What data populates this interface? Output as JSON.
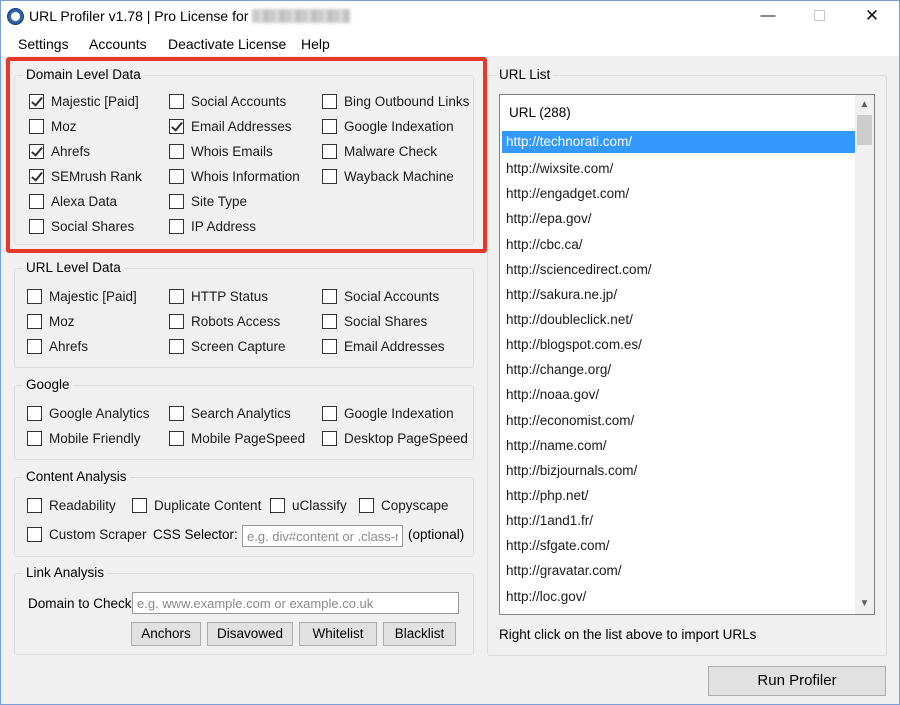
{
  "window": {
    "title_prefix": "URL Profiler v1.78 | Pro License for",
    "minimize_glyph": "—",
    "close_glyph": "✕"
  },
  "menu": [
    "Settings",
    "Accounts",
    "Deactivate License",
    "Help"
  ],
  "domain_level": {
    "label": "Domain Level Data",
    "items": [
      {
        "label": "Majestic [Paid]",
        "checked": true
      },
      {
        "label": "Moz",
        "checked": false
      },
      {
        "label": "Ahrefs",
        "checked": true
      },
      {
        "label": "SEMrush Rank",
        "checked": true
      },
      {
        "label": "Alexa Data",
        "checked": false
      },
      {
        "label": "Social Shares",
        "checked": false
      },
      {
        "label": "Social Accounts",
        "checked": false
      },
      {
        "label": "Email Addresses",
        "checked": true
      },
      {
        "label": "Whois Emails",
        "checked": false
      },
      {
        "label": "Whois Information",
        "checked": false
      },
      {
        "label": "Site Type",
        "checked": false
      },
      {
        "label": "IP Address",
        "checked": false
      },
      {
        "label": "Bing Outbound Links",
        "checked": false
      },
      {
        "label": "Google Indexation",
        "checked": false
      },
      {
        "label": "Malware Check",
        "checked": false
      },
      {
        "label": "Wayback Machine",
        "checked": false
      }
    ]
  },
  "url_level": {
    "label": "URL Level Data",
    "items": [
      {
        "label": "Majestic [Paid]",
        "checked": false
      },
      {
        "label": "Moz",
        "checked": false
      },
      {
        "label": "Ahrefs",
        "checked": false
      },
      {
        "label": "HTTP Status",
        "checked": false
      },
      {
        "label": "Robots Access",
        "checked": false
      },
      {
        "label": "Screen Capture",
        "checked": false
      },
      {
        "label": "Social Accounts",
        "checked": false
      },
      {
        "label": "Social Shares",
        "checked": false
      },
      {
        "label": "Email Addresses",
        "checked": false
      }
    ]
  },
  "google": {
    "label": "Google",
    "items": [
      {
        "label": "Google Analytics",
        "checked": false
      },
      {
        "label": "Mobile Friendly",
        "checked": false
      },
      {
        "label": "Search Analytics",
        "checked": false
      },
      {
        "label": "Mobile PageSpeed",
        "checked": false
      },
      {
        "label": "Google Indexation",
        "checked": false
      },
      {
        "label": "Desktop PageSpeed",
        "checked": false
      }
    ]
  },
  "content_analysis": {
    "label": "Content Analysis",
    "items": [
      {
        "label": "Readability",
        "checked": false
      },
      {
        "label": "Duplicate Content",
        "checked": false
      },
      {
        "label": "uClassify",
        "checked": false
      },
      {
        "label": "Copyscape",
        "checked": false
      },
      {
        "label": "Custom Scraper",
        "checked": false
      }
    ],
    "css_selector_label": "CSS Selector:",
    "css_selector_placeholder": "e.g. div#content or .class-name",
    "optional_label": "(optional)"
  },
  "link_analysis": {
    "label": "Link Analysis",
    "domain_label": "Domain to Check:",
    "domain_placeholder": "e.g. www.example.com or example.co.uk",
    "buttons": [
      "Anchors",
      "Disavowed",
      "Whitelist",
      "Blacklist"
    ]
  },
  "url_list": {
    "label": "URL List",
    "header": "URL (288)",
    "selected_index": 0,
    "urls": [
      "http://technorati.com/",
      "http://wixsite.com/",
      "http://engadget.com/",
      "http://epa.gov/",
      "http://cbc.ca/",
      "http://sciencedirect.com/",
      "http://sakura.ne.jp/",
      "http://doubleclick.net/",
      "http://blogspot.com.es/",
      "http://change.org/",
      "http://noaa.gov/",
      "http://economist.com/",
      "http://name.com/",
      "http://bizjournals.com/",
      "http://php.net/",
      "http://1and1.fr/",
      "http://sfgate.com/",
      "http://gravatar.com/",
      "http://loc.gov/"
    ],
    "hint": "Right click on the list above to import URLs"
  },
  "run_button": "Run Profiler",
  "colors": {
    "highlight": "#e8372b",
    "selection": "#3399ff"
  }
}
